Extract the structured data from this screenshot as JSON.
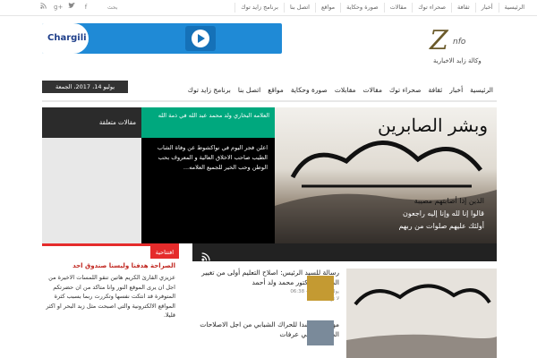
{
  "topbar": {
    "nav_items": [
      "الرئيسية",
      "أخبار",
      "ثقافة",
      "صحراء توك",
      "مقالات",
      "صورة وحكاية",
      "مواقع",
      "اتصل بنا",
      "برنامج زايد توك"
    ],
    "search_label": "بحث",
    "social_icons": [
      "rss-icon",
      "google-plus-icon",
      "twitter-icon",
      "facebook-icon"
    ]
  },
  "logo": {
    "mark": "Z",
    "suffix": "nfo",
    "subtitle": "وكالة زايد الاخبارية"
  },
  "banner": {
    "brand": "Chargili"
  },
  "date": "يوليو 14، 2017، الجمعة",
  "mainnav": {
    "items": [
      "الرئيسية",
      "أخبار",
      "ثقافة",
      "صحراء توك",
      "مقالات",
      "مقابلات",
      "صورة وحكاية",
      "مواقع",
      "اتصل بنا",
      "برنامج زايد توك"
    ]
  },
  "slider": {
    "top_caption": "العلامه البخاري ولد محمد عبد الله في ذمة الله",
    "body_text": "اعلن فجر اليوم في نواكشوط عن وفاة الشاب الطيب صاحب الاخلاق العالية و المعروف بحب الوطن وحب الخير للجميع العلامه..."
  },
  "related": {
    "title": "مقالات متعلقة"
  },
  "featured_image": {
    "verse": "وبشر الصابرين",
    "line1": "الذين إذا أصابتهم مصيبة",
    "line2": "قالوا إنا لله وإنا إليه راجعون",
    "line3": "أولئك عليهم صلوات من ربهم"
  },
  "editorial": {
    "label": "افتتاحية",
    "headline": "الصراحة هدفنا وليسنا صندوق احد",
    "text": "عزيزي القارئ الكريم هاتين تنقو اللمسات الاخيرة من اجل ان يرى الموقع النور وانا متاكد من ان حضرتكم المتوفرة قد انتكت نفسها وتكررت ربما بسبب كثرة المواقع الالكترونية والتي اصبحت مثل زبد البحر او اكثر قليلا."
  },
  "news": [
    {
      "title": "رسالة للسيد الرئيس: اصلاح التعليم أولى من تغيير الدستور الدكتور محمد ولد أحمد",
      "date": "يوليو 8، 2017 - 06:38",
      "comments": "لا توجد تعليقات"
    },
    {
      "title": "مهرجانا حاشدا للحراك الشبابي من اجل الاصلاحات الدستورية في عرفات",
      "date": "",
      "comments": ""
    }
  ],
  "colors": {
    "accent_green": "#00a87e",
    "editorial_red": "#e52b2b",
    "banner_blue": "#1f8ad6"
  }
}
